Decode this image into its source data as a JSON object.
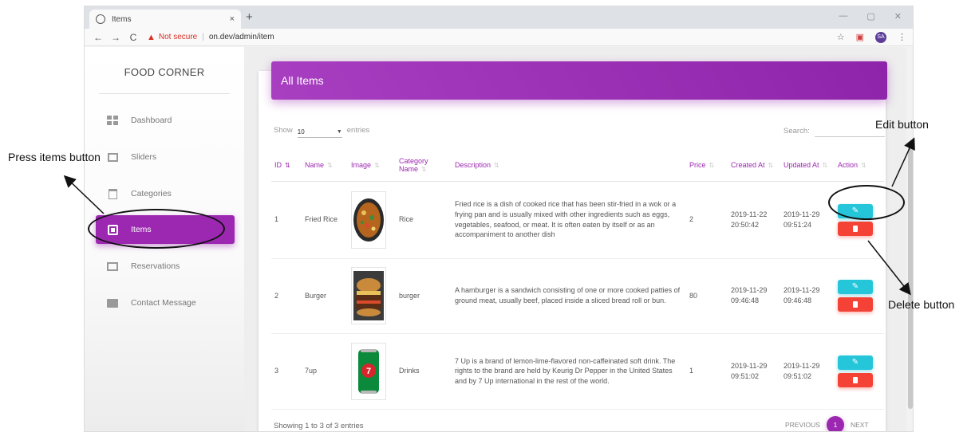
{
  "browser": {
    "tab_title": "Items",
    "new_tab": "+",
    "close_tab": "×",
    "window_controls": {
      "minimize": "—",
      "restore": "▢",
      "close": "✕"
    },
    "not_secure": "Not secure",
    "url": "on.dev/admin/item",
    "avatar_initials": "SA"
  },
  "sidebar": {
    "brand": "FOOD CORNER",
    "items": [
      {
        "label": "Dashboard",
        "icon": "dashboard-icon"
      },
      {
        "label": "Sliders",
        "icon": "slider-icon"
      },
      {
        "label": "Categories",
        "icon": "clipboard-icon"
      },
      {
        "label": "Items",
        "icon": "library-icon",
        "active": true
      },
      {
        "label": "Reservations",
        "icon": "chrome-reader-icon"
      },
      {
        "label": "Contact Message",
        "icon": "message-icon"
      }
    ]
  },
  "main": {
    "card_title": "All Items",
    "show_label": "Show",
    "entries_value": "10",
    "entries_label": "entries",
    "search_label": "Search:",
    "search_value": "",
    "columns": [
      "ID",
      "Name",
      "Image",
      "Category Name",
      "Description",
      "Price",
      "Created At",
      "Updated At",
      "Action"
    ],
    "rows": [
      {
        "id": "1",
        "name": "Fried Rice",
        "image": "fried-rice-image",
        "category": "Rice",
        "description": "Fried rice is a dish of cooked rice that has been stir-fried in a wok or a frying pan and is usually mixed with other ingredients such as eggs, vegetables, seafood, or meat. It is often eaten by itself or as an accompaniment to another dish",
        "price": "2",
        "created": "2019-11-22 20:50:42",
        "updated": "2019-11-29 09:51:24"
      },
      {
        "id": "2",
        "name": "Burger",
        "image": "burger-image",
        "category": "burger",
        "description": "A hamburger is a sandwich consisting of one or more cooked patties of ground meat, usually beef, placed inside a sliced bread roll or bun.",
        "price": "80",
        "created": "2019-11-29 09:46:48",
        "updated": "2019-11-29 09:46:48"
      },
      {
        "id": "3",
        "name": "7up",
        "image": "7up-can-image",
        "category": "Drinks",
        "description": "7 Up is a brand of lemon-lime-flavored non-caffeinated soft drink. The rights to the brand are held by Keurig Dr Pepper in the United States and by 7 Up international in the rest of the world.",
        "price": "1",
        "created": "2019-11-29 09:51:02",
        "updated": "2019-11-29 09:51:02"
      }
    ],
    "footer_info": "Showing 1 to 3 of 3 entries",
    "pagination": {
      "previous": "PREVIOUS",
      "current": "1",
      "next": "NEXT"
    }
  },
  "annotations": {
    "press_items": "Press items button",
    "edit_button": "Edit button",
    "delete_button": "Delete button"
  },
  "colors": {
    "primary": "#9c27b0",
    "edit": "#26c6da",
    "delete": "#f44336"
  }
}
